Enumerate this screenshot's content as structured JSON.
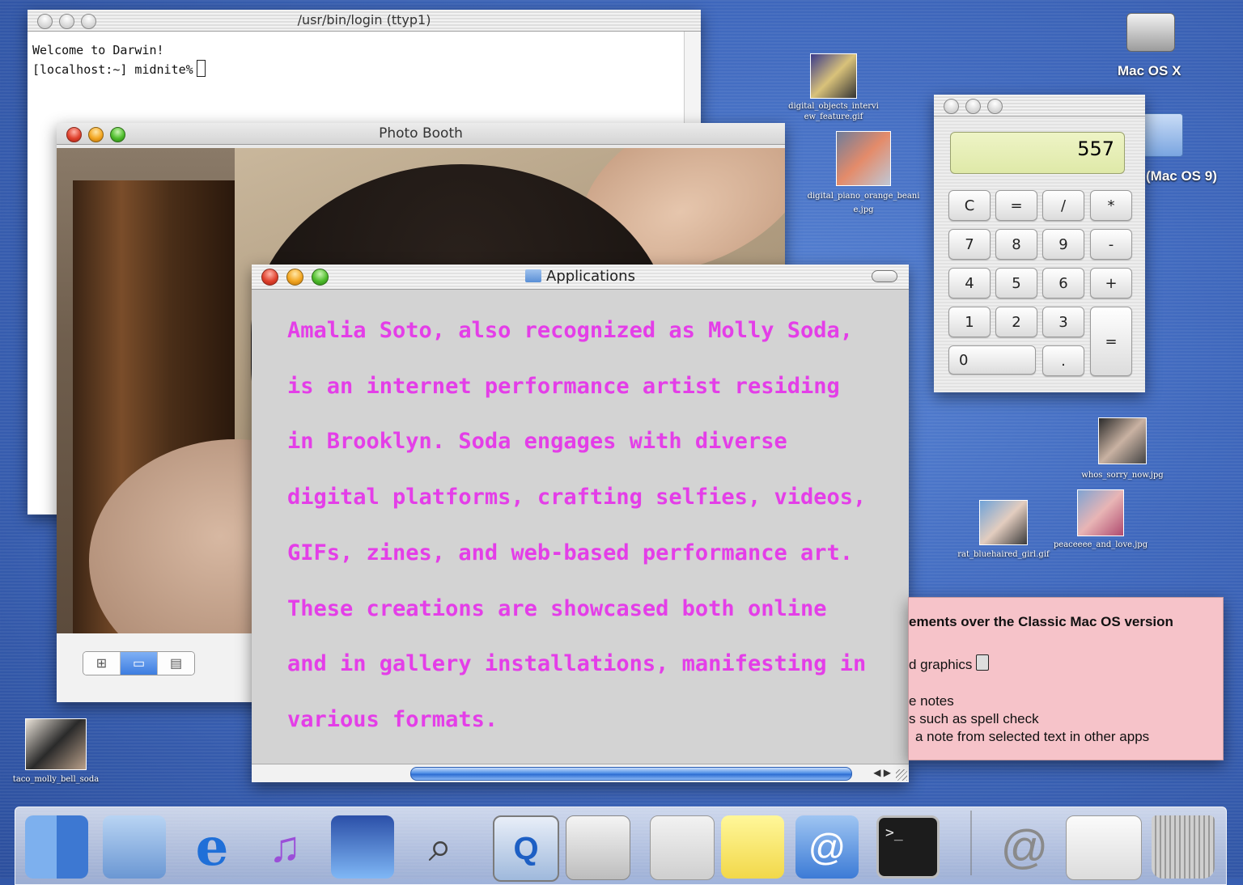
{
  "terminal": {
    "title": "/usr/bin/login  (ttyp1)",
    "lines": [
      "Welcome to Darwin!",
      "[localhost:~] midnite%"
    ]
  },
  "photobooth": {
    "title": "Photo Booth",
    "view_modes": [
      "grid-view-icon",
      "single-view-icon",
      "filmstrip-view-icon"
    ]
  },
  "applications": {
    "title": "Applications",
    "lines": [
      "Amalia Soto, also recognized as Molly Soda,",
      "is an internet performance artist residing",
      "in Brooklyn. Soda engages with diverse",
      "digital platforms, crafting selfies, videos,",
      "GIFs, zines, and web-based performance art.",
      "These creations are showcased both online",
      "and in gallery installations, manifesting in",
      "various formats."
    ],
    "text_color": "#e43ee8"
  },
  "calculator": {
    "display": "557",
    "keys": [
      "C",
      "=",
      "/",
      "*",
      "7",
      "8",
      "9",
      "-",
      "4",
      "5",
      "6",
      "+",
      "1",
      "2",
      "3",
      "=",
      "0",
      "."
    ]
  },
  "stickies": {
    "heading": "ements over the Classic Mac OS version",
    "line1": "d graphics",
    "line2": "e notes",
    "line3": "s such as spell check",
    "line4": "a note from selected text in other apps"
  },
  "desktop": {
    "hd_label": "Mac OS X",
    "os9_label": "(Mac OS 9)",
    "icons": [
      {
        "label": "digital_objects_interview_feature.gif"
      },
      {
        "label": "digital_piano_orange_beanie.jpg"
      },
      {
        "label": "whos_sorry_now.jpg"
      },
      {
        "label": "rat_bluehaired_girl.gif"
      },
      {
        "label": "peaceeee_and_love.jpg"
      },
      {
        "label": "taco_molly_bell_soda"
      }
    ]
  },
  "dock": {
    "items": [
      "finder-icon",
      "mail-icon",
      "internet-explorer-icon",
      "itunes-icon",
      "imovie-icon",
      "sherlock-icon",
      "quicktime-icon",
      "system-preferences-icon",
      "calculator-icon",
      "stickies-icon",
      "address-book-icon",
      "terminal-icon",
      "internet-connect-icon",
      "window-icon",
      "trash-icon"
    ]
  }
}
